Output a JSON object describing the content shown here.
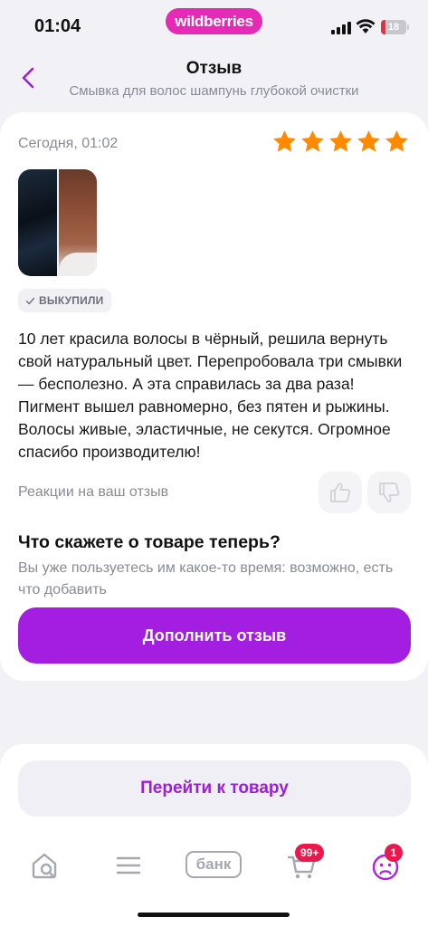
{
  "status_bar": {
    "time": "01:04",
    "battery": "18"
  },
  "brand": {
    "logo_text": "wildberries",
    "color": "#e62ab8"
  },
  "header": {
    "title": "Отзыв",
    "subtitle": "Смывка для волос шампунь глубокой очистки"
  },
  "review": {
    "date": "Сегодня, 01:02",
    "rating": 5,
    "rating_max": 5,
    "star_color": "#ff8a00",
    "badge": "ВЫКУПИЛИ",
    "text": "10 лет красила волосы в чёрный, решила вернуть свой натуральный цвет. Перепробовала три смывки — бесполезно. А эта справилась за два раза! Пигмент вышел равномерно, без пятен и рыжины. Волосы живые, эластичные, не секутся. Огромное спасибо производителю!",
    "reactions_label": "Реакции на ваш отзыв"
  },
  "followup": {
    "title": "Что скажете о товаре теперь?",
    "subtitle": "Вы уже пользуетесь им какое-то время: возможно, есть что добавить",
    "button": "Дополнить отзыв",
    "button_color": "#a31ee0"
  },
  "bottom": {
    "go_button": "Перейти к товару"
  },
  "tabbar": {
    "bank_label": "банк",
    "cart_badge": "99+",
    "profile_badge": "1"
  }
}
